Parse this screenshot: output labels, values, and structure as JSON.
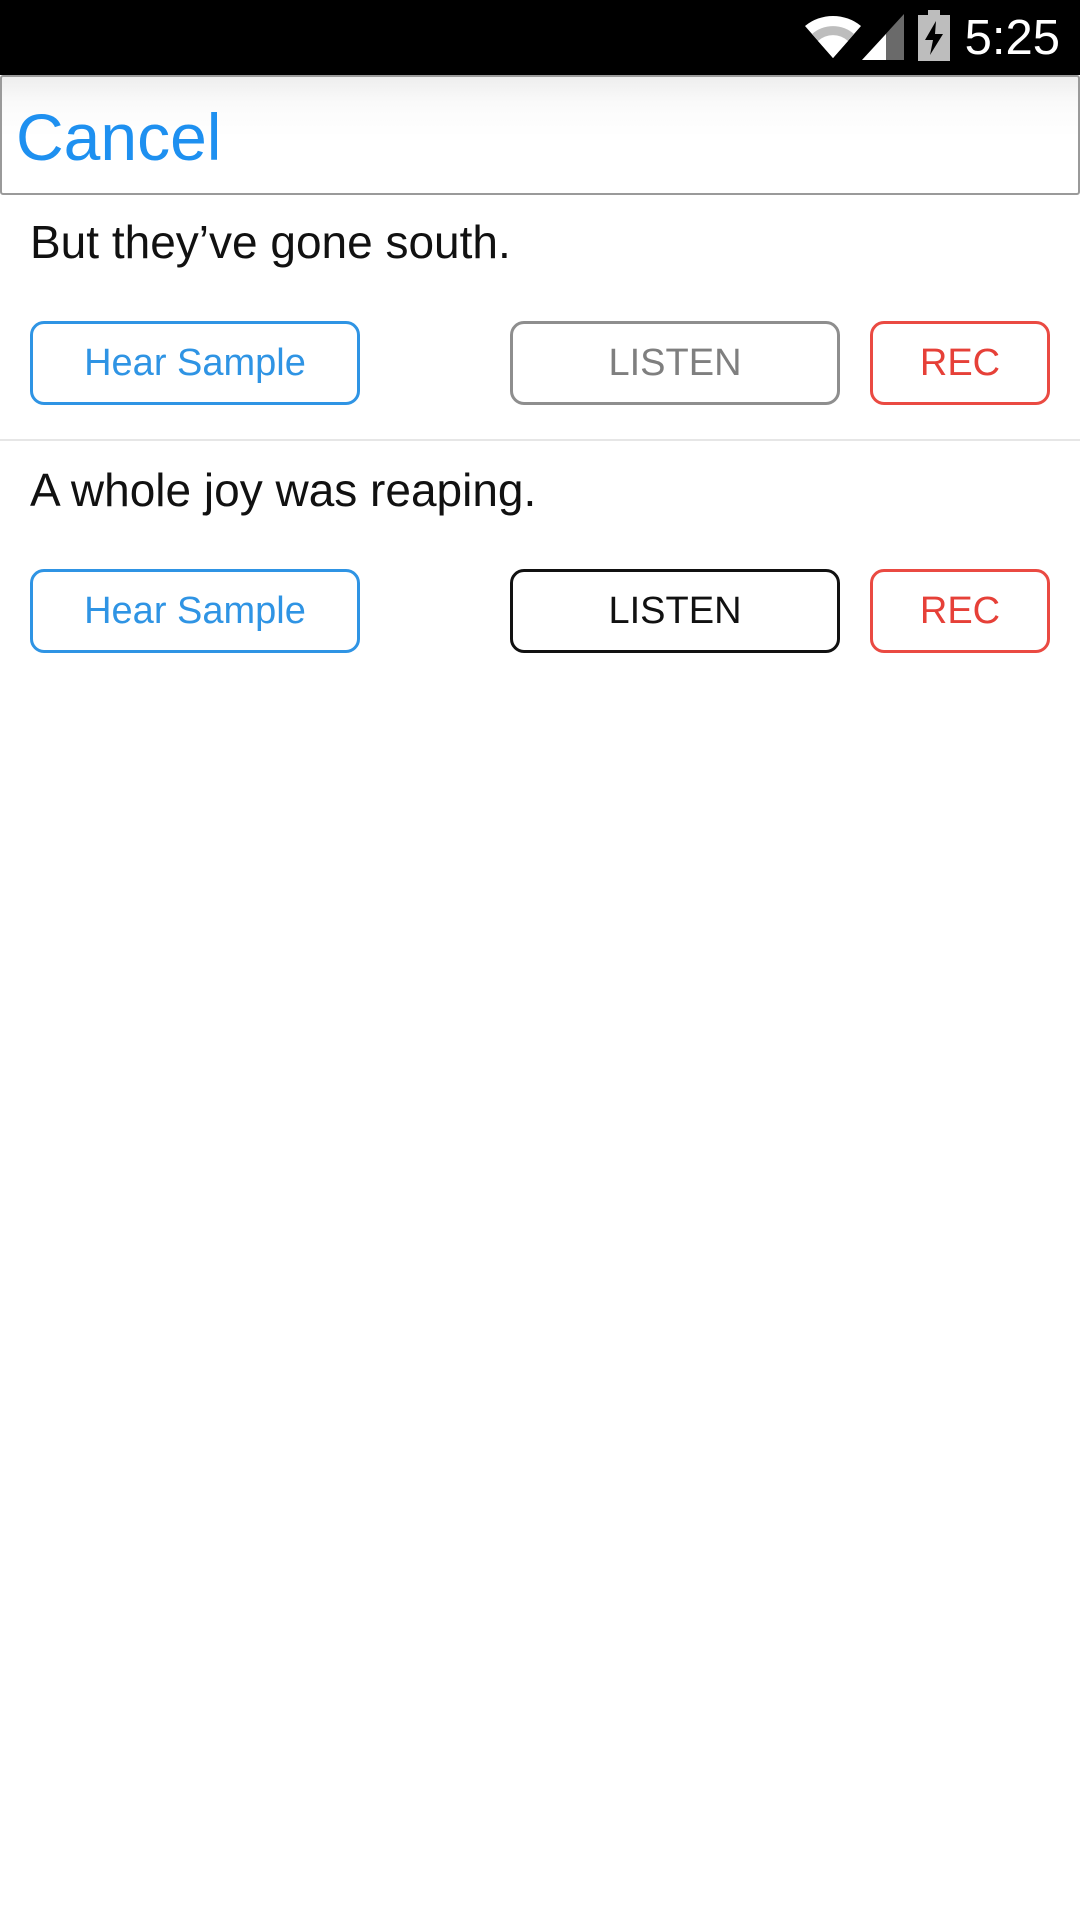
{
  "status_bar": {
    "time": "5:25",
    "icons": [
      "wifi-icon",
      "cellular-signal-icon",
      "battery-charging-icon"
    ]
  },
  "top_bar": {
    "cancel_label": "Cancel"
  },
  "phrases": [
    {
      "text": "But they’ve gone south.",
      "sample_label": "Hear Sample",
      "listen_label": "LISTEN",
      "rec_label": "REC",
      "listen_enabled": false
    },
    {
      "text": "A whole joy was reaping.",
      "sample_label": "Hear Sample",
      "listen_label": "LISTEN",
      "rec_label": "REC",
      "listen_enabled": true
    }
  ],
  "colors": {
    "accent_blue": "#2f94e4",
    "cancel_blue": "#1e90f0",
    "record_red": "#e64038",
    "listen_disabled_gray": "#7f7f7f",
    "listen_enabled_black": "#111111"
  }
}
